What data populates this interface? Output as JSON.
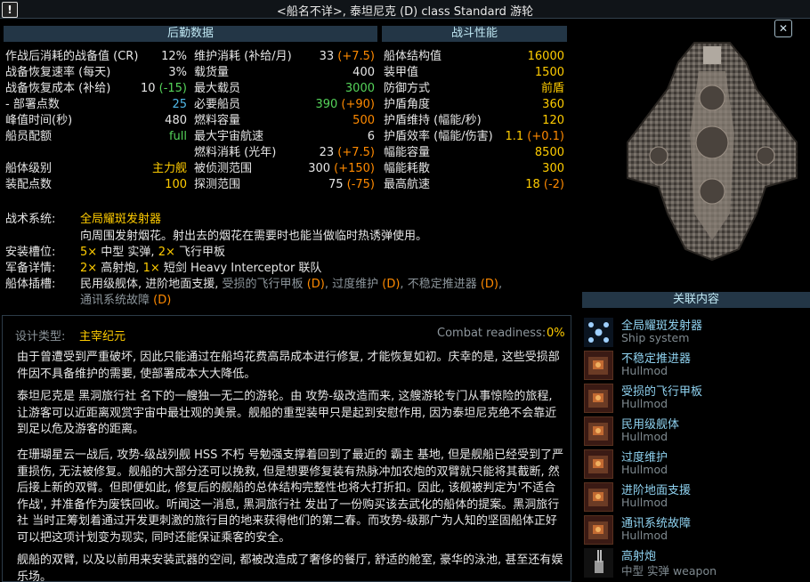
{
  "window": {
    "title": "<船名不详>, 泰坦尼克 (D) class Standard 游轮",
    "alert_icon": "!",
    "close_icon": "✕"
  },
  "logistics": {
    "header": "后勤数据",
    "left": [
      {
        "label": "作战后消耗的战备值 (CR)",
        "value": "12%",
        "color": "white"
      },
      {
        "label": "战备恢复速率 (每天)",
        "value": "3%",
        "color": "white"
      },
      {
        "label": "战备恢复成本 (补给)",
        "value": "10",
        "extra": " (-15)",
        "color": "white",
        "extra_color": "green"
      },
      {
        "label": " - 部署点数",
        "value": "25",
        "color": "cyan"
      },
      {
        "label": "峰值时间(秒)",
        "value": "480",
        "color": "white"
      },
      {
        "label": "船员配额",
        "value": "full",
        "color": "green"
      },
      {
        "label": "",
        "value": "",
        "color": "white"
      },
      {
        "label": "船体级别",
        "value": "主力舰",
        "color": "yellow"
      },
      {
        "label": "装配点数",
        "value": "100",
        "color": "yellow"
      }
    ],
    "right": [
      {
        "label": "维护消耗 (补给/月)",
        "value": "33",
        "extra": " (+7.5)",
        "color": "white",
        "extra_color": "orange"
      },
      {
        "label": "载货量",
        "value": "400",
        "color": "white"
      },
      {
        "label": "最大载员",
        "value": "3000",
        "color": "green"
      },
      {
        "label": "必要船员",
        "value": "390",
        "extra": " (+90)",
        "color": "green",
        "extra_color": "orange"
      },
      {
        "label": "燃料容量",
        "value": "500",
        "color": "orange"
      },
      {
        "label": "最大宇宙航速",
        "value": "6",
        "color": "white"
      },
      {
        "label": "燃料消耗 (光年)",
        "value": "23",
        "extra": " (+7.5)",
        "color": "white",
        "extra_color": "orange"
      },
      {
        "label": "被侦测范围",
        "value": "300",
        "extra": " (+150)",
        "color": "white",
        "extra_color": "orange"
      },
      {
        "label": "探测范围",
        "value": "75",
        "extra": " (-75)",
        "color": "white",
        "extra_color": "orange"
      }
    ]
  },
  "combat": {
    "header": "战斗性能",
    "rows": [
      {
        "label": "船体结构值",
        "value": "16000",
        "color": "yellow"
      },
      {
        "label": "装甲值",
        "value": "1500",
        "color": "yellow"
      },
      {
        "label": "防御方式",
        "value": "前盾",
        "color": "yellow"
      },
      {
        "label": "护盾角度",
        "value": "360",
        "color": "yellow"
      },
      {
        "label": "护盾维持 (幅能/秒)",
        "value": "120",
        "color": "yellow"
      },
      {
        "label": "护盾效率 (幅能/伤害)",
        "value": "1.1",
        "extra": " (+0.1)",
        "color": "yellow",
        "extra_color": "orange"
      },
      {
        "label": "幅能容量",
        "value": "8500",
        "color": "yellow"
      },
      {
        "label": "幅能耗散",
        "value": "300",
        "color": "yellow"
      },
      {
        "label": "最高航速",
        "value": "18",
        "extra": " (-2)",
        "color": "yellow",
        "extra_color": "orange"
      }
    ]
  },
  "systems": {
    "tactical_label": "战术系统:",
    "tactical_name": "全局耀斑发射器",
    "tactical_desc": "向周围发射烟花。射出去的烟花在需要时也能当做临时热诱弹使用。",
    "mounts_label": "安装槽位:",
    "mounts_a_count": "5×",
    "mounts_a": " 中型 实弹, ",
    "mounts_b_count": "2×",
    "mounts_b": " 飞行甲板",
    "armament_label": "军备详情:",
    "armament_a_count": "2×",
    "armament_a": " 高射炮, ",
    "armament_b_count": "1×",
    "armament_b": " 短剑 Heavy Interceptor 联队",
    "hullmods_label": "船体插槽:",
    "hullmods_white": "民用级舰体, 进阶地面支援, ",
    "hullmod_d1": "受损的飞行甲板",
    "hullmod_d2": "过度维护",
    "hullmod_d3": "不稳定推进器",
    "hullmod_d4": "通讯系统故障",
    "d_tag": "(D)"
  },
  "ship_art": {
    "icon": "titanic-ship-sprite"
  },
  "related": {
    "header": "关联内容",
    "items": [
      {
        "name": "全局耀斑发射器",
        "type": "Ship system",
        "icon": "flare-icon"
      },
      {
        "name": "不稳定推进器",
        "type": "Hullmod",
        "icon": "hullmod-icon"
      },
      {
        "name": "受损的飞行甲板",
        "type": "Hullmod",
        "icon": "hullmod-icon"
      },
      {
        "name": "民用级舰体",
        "type": "Hullmod",
        "icon": "hullmod-icon"
      },
      {
        "name": "过度维护",
        "type": "Hullmod",
        "icon": "hullmod-icon"
      },
      {
        "name": "进阶地面支援",
        "type": "Hullmod",
        "icon": "hullmod-icon"
      },
      {
        "name": "通讯系统故障",
        "type": "Hullmod",
        "icon": "hullmod-icon"
      },
      {
        "name": "高射炮",
        "type": "中型 实弹 weapon",
        "icon": "weapon-icon"
      }
    ]
  },
  "description": {
    "design_label": "设计类型:",
    "design_value": "主宰纪元",
    "cr_label": "Combat readiness:",
    "cr_value": "0%",
    "paragraphs": [
      "由于曾遭受到严重破坏, 因此只能通过在船坞花费高昂成本进行修复, 才能恢复如初。庆幸的是, 这些受损部件因不具备维护的需要, 使部署成本大大降低。",
      "泰坦尼克是 黑洞旅行社 名下的一艘独一无二的游轮。由 攻势-级改造而来, 这艘游轮专门从事惊险的旅程, 让游客可以近距离观赏宇宙中最壮观的美景。舰船的重型装甲只是起到安慰作用, 因为泰坦尼克绝不会靠近到足以危及游客的距离。",
      "在珊瑚星云一战后, 攻势-级战列舰 HSS 不朽 号勉强支撑着回到了最近的 霸主 基地, 但是舰船已经受到了严重损伤, 无法被修复。舰船的大部分还可以挽救, 但是想要修复装有热脉冲加农炮的双臂就只能将其截断, 然后接上新的双臂。但即便如此, 修复后的舰船的总体结构完整性也将大打折扣。因此, 该舰被判定为'不适合作战', 并准备作为废铁回收。听闻这一消息, 黑洞旅行社 发出了一份购买该去武化的船体的提案。黑洞旅行社 当时正筹划着通过开发更刺激的旅行目的地来获得他们的第二春。而攻势-级那广为人知的坚固船体正好可以把这项计划变为现实, 同时还能保证乘客的安全。",
      "舰船的双臂, 以及以前用来安装武器的空间, 都被改造成了奢侈的餐厅, 舒适的舱室, 豪华的泳池, 甚至还有娱乐场。"
    ]
  }
}
